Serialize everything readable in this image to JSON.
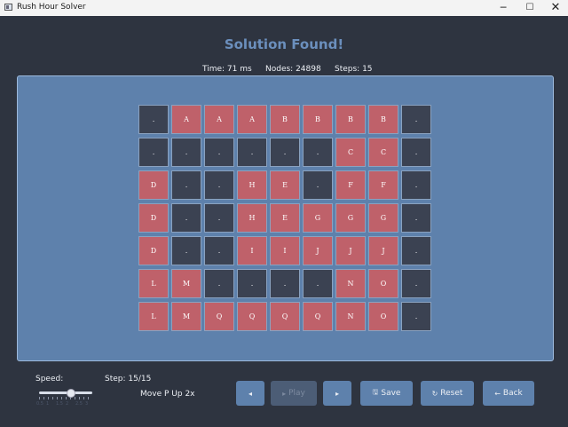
{
  "window": {
    "title": "Rush Hour Solver",
    "minimize_glyph": "─",
    "maximize_glyph": "☐",
    "close_glyph": "✕"
  },
  "heading": "Solution Found!",
  "stats": {
    "time": "Time: 71 ms",
    "nodes": "Nodes: 24898",
    "steps": "Steps: 15"
  },
  "board": {
    "rows": [
      [
        ".",
        "A",
        "A",
        "A",
        "B",
        "B",
        "B",
        "B",
        "."
      ],
      [
        ".",
        ".",
        ".",
        ".",
        ".",
        ".",
        "C",
        "C",
        "."
      ],
      [
        "D",
        ".",
        ".",
        "H",
        "E",
        ".",
        "F",
        "F",
        "."
      ],
      [
        "D",
        ".",
        ".",
        "H",
        "E",
        "G",
        "G",
        "G",
        "."
      ],
      [
        "D",
        ".",
        ".",
        "I",
        "I",
        "J",
        "J",
        "J",
        "."
      ],
      [
        "L",
        "M",
        ".",
        ".",
        ".",
        ".",
        "N",
        "O",
        "."
      ],
      [
        "L",
        "M",
        "Q",
        "Q",
        "Q",
        "Q",
        "N",
        "O",
        "."
      ]
    ],
    "empty_color": "#3b4252",
    "car_color": "#bf616a",
    "background_color": "#5e81ac"
  },
  "controls": {
    "speed_label": "Speed:",
    "speed_value": 0.6,
    "speed_ticks": [
      "0.5",
      "1",
      "1.5",
      "2",
      "2.5",
      "3"
    ],
    "step_label": "Step: 15/15",
    "move_text": "Move P Up 2x",
    "prev_icon": "◂",
    "play_icon": "▸",
    "play_label": "Play",
    "next_icon": "▸",
    "save_icon": "🖫",
    "save_label": "Save",
    "reset_icon": "↻",
    "reset_label": "Reset",
    "back_icon": "←",
    "back_label": "Back"
  },
  "colors": {
    "app_background": "#2e3440",
    "accent": "#5e81ac",
    "heading": "#6b8fbd"
  }
}
